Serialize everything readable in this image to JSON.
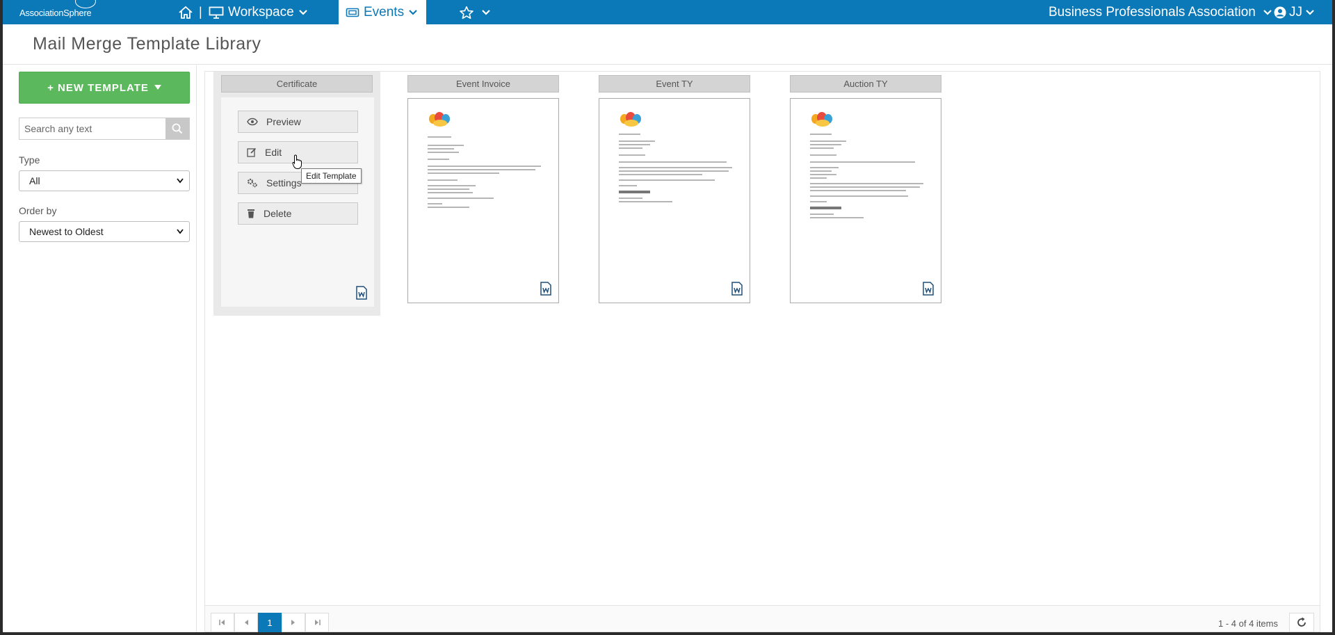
{
  "nav": {
    "logo": "AssociationSphere",
    "separator": "|",
    "workspace": "Workspace",
    "events": "Events",
    "organization": "Business Professionals Association",
    "user_initials": "JJ"
  },
  "header": {
    "title": "Mail Merge Template Library"
  },
  "sidebar": {
    "new_template": "+ NEW TEMPLATE",
    "search_placeholder": "Search any text",
    "type_label": "Type",
    "type_value": "All",
    "order_label": "Order by",
    "order_value": "Newest to Oldest"
  },
  "templates": [
    {
      "name": "Certificate"
    },
    {
      "name": "Event Invoice"
    },
    {
      "name": "Event TY"
    },
    {
      "name": "Auction TY"
    }
  ],
  "actions": {
    "preview": "Preview",
    "edit": "Edit",
    "settings": "Settings",
    "delete": "Delete",
    "tooltip": "Edit Template"
  },
  "pager": {
    "current_page": "1",
    "items_summary": "1 - 4 of 4 items"
  },
  "colors": {
    "brand": "#0b78b7",
    "primary_action": "#5cb85c"
  }
}
